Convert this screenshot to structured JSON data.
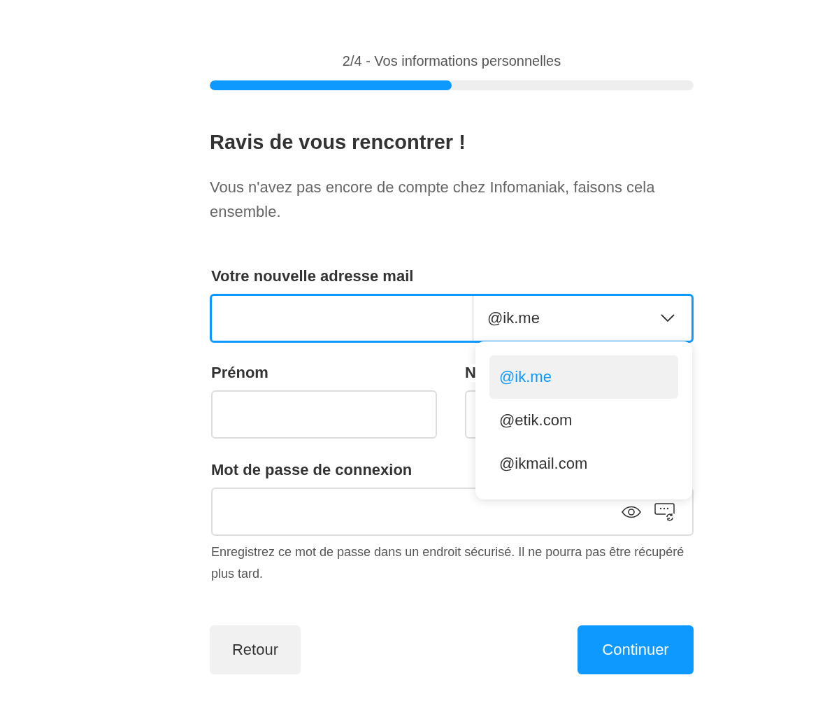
{
  "progress": {
    "step": "2/4 - Vos informations personnelles",
    "level": 0.5
  },
  "title": "Ravis de vous rencontrer !",
  "intro": "Vous n'avez pas encore de compte chez Infomaniak, faisons cela ensemble.",
  "email": {
    "label": "Votre nouvelle adresse mail",
    "domain": "@ik.me",
    "expanded": true,
    "options": [
      {
        "label": "@ik.me",
        "selected": true
      },
      {
        "label": "@etik.com",
        "selected": false
      },
      {
        "label": "@ikmail.com",
        "selected": false
      }
    ]
  },
  "first_name": {
    "label": "Prénom"
  },
  "last_name": {
    "label": "N"
  },
  "password": {
    "label": "Mot de passe de connexion",
    "help": "Enregistrez ce mot de passe dans un endroit sécurisé. Il ne pourra pas être récupéré plus tard."
  },
  "buttons": [
    {
      "label": "Retour",
      "kind": "secondary"
    },
    {
      "label": "Continuer",
      "kind": "primary"
    }
  ]
}
